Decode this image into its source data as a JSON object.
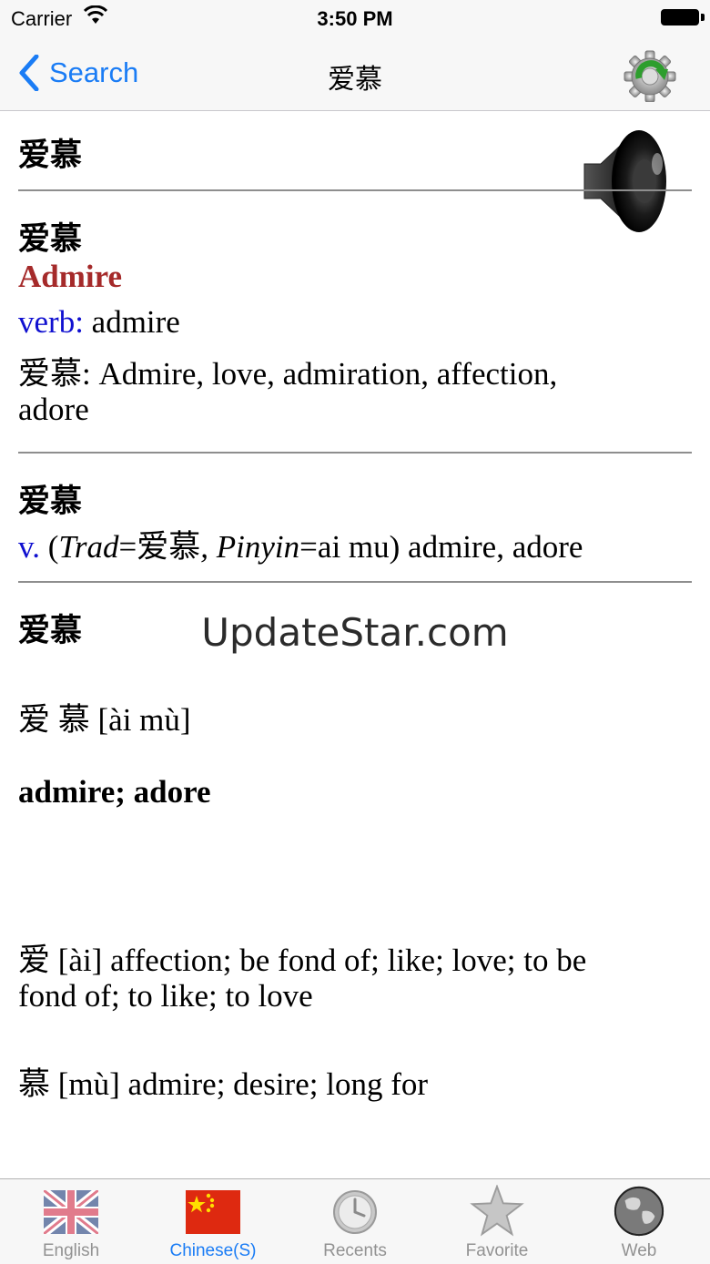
{
  "status_bar": {
    "carrier": "Carrier",
    "time": "3:50 PM"
  },
  "nav": {
    "back_label": "Search",
    "title": "爱慕",
    "refresh_icon": "gear-refresh-icon"
  },
  "entries": {
    "e1": {
      "headword": "爱慕",
      "speaker_icon": "speaker-icon"
    },
    "e2": {
      "headword": "爱慕",
      "translation": "Admire",
      "pos": "verb:",
      "pos_meaning": " admire",
      "def_line1": "爱慕: Admire, love, admiration, affection,",
      "def_line2": "adore"
    },
    "e3": {
      "headword": "爱慕",
      "pos": "v.",
      "open_paren": " (",
      "trad_label": "Trad",
      "trad_eq": "=爱慕",
      "comma": ", ",
      "pinyin_label": "Pinyin",
      "pinyin_eq": "=ai mu) admire, adore"
    },
    "e4": {
      "headword": "爱慕",
      "pinyin": "爱 慕 [ài mù]",
      "meaning": "admire; adore",
      "char1_line1": "爱 [ài] affection; be fond of; like; love; to be",
      "char1_line2": "fond of; to like; to love",
      "char2": "慕 [mù] admire; desire; long for"
    }
  },
  "watermark": "UpdateStar.com",
  "tabs": [
    {
      "label": "English",
      "icon": "uk-flag-icon",
      "active": false
    },
    {
      "label": "Chinese(S)",
      "icon": "china-flag-icon",
      "active": true
    },
    {
      "label": "Recents",
      "icon": "clock-icon",
      "active": false
    },
    {
      "label": "Favorite",
      "icon": "star-icon",
      "active": false
    },
    {
      "label": "Web",
      "icon": "globe-icon",
      "active": false
    }
  ],
  "colors": {
    "accent": "#1a7cf5",
    "translation": "#a52a2a",
    "pos": "#1010d0",
    "tab_inactive": "#929292"
  }
}
